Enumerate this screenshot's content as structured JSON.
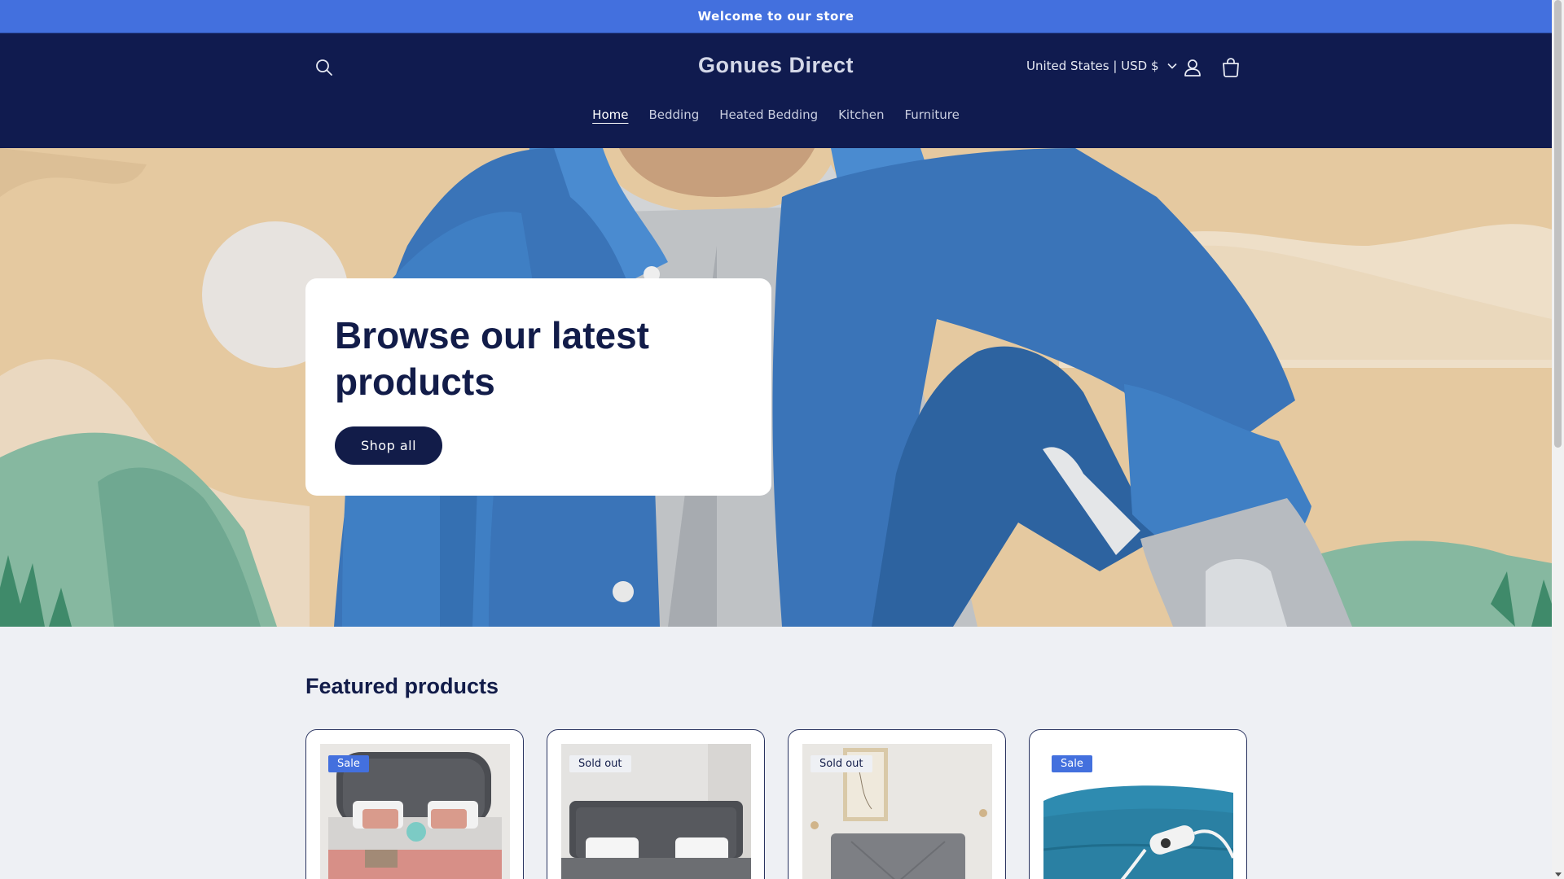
{
  "announcement": "Welcome to our store",
  "header": {
    "logo": "Gonues Direct",
    "country": "United States | USD $",
    "icons": [
      "search-icon",
      "user-icon",
      "cart-icon",
      "chevron-down-icon"
    ]
  },
  "nav": {
    "items": [
      {
        "label": "Home",
        "active": true
      },
      {
        "label": "Bedding"
      },
      {
        "label": "Heated Bedding"
      },
      {
        "label": "Kitchen"
      },
      {
        "label": "Furniture"
      }
    ]
  },
  "hero": {
    "title": "Browse our latest products",
    "button": "Shop all"
  },
  "featured": {
    "title": "Featured products",
    "products": [
      {
        "badge": "Sale"
      },
      {
        "badge": "Sold out"
      },
      {
        "badge": "Sold out"
      },
      {
        "badge": "Sale"
      }
    ]
  },
  "colors": {
    "announcement_bg": "#4370de",
    "header_bg": "#101b4f",
    "accent": "#121c49",
    "sale_badge": "#4370de",
    "page_bg": "#eef0f4"
  }
}
